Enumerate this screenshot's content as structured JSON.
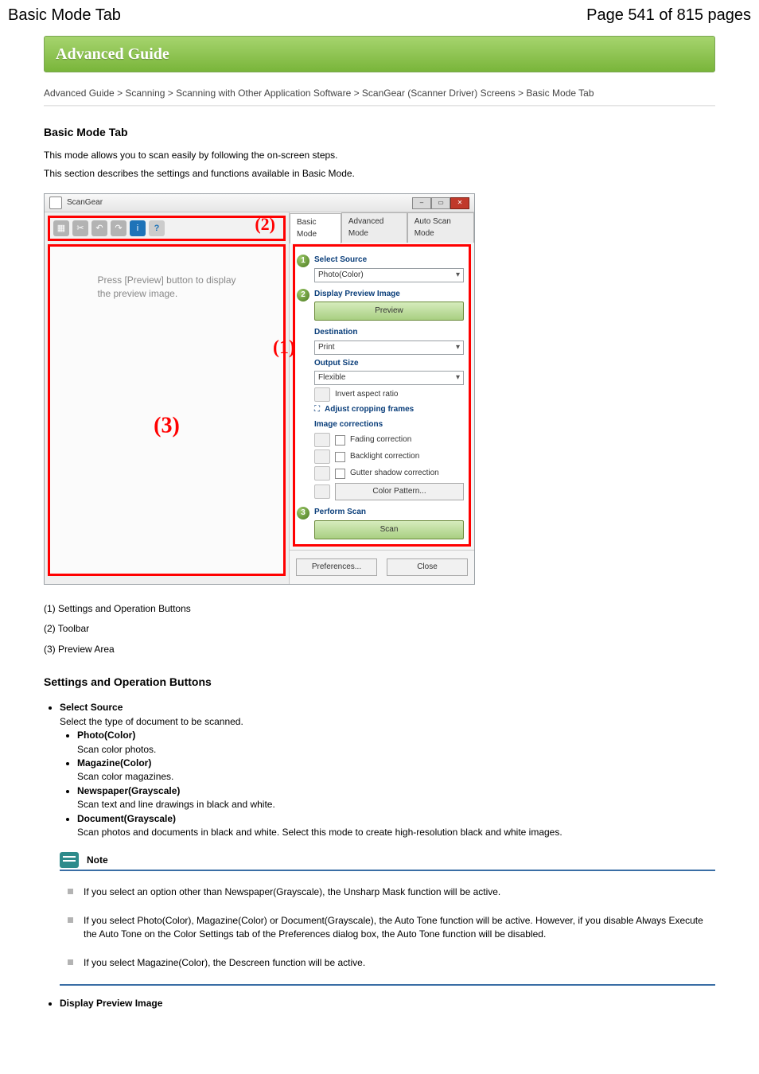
{
  "header": {
    "left_title": "Basic Mode Tab",
    "right_title": "Page 541 of 815 pages"
  },
  "banner": "Advanced Guide",
  "breadcrumbs": "Advanced Guide > Scanning > Scanning with Other Application Software > ScanGear (Scanner Driver) Screens > Basic Mode Tab",
  "title": "Basic Mode Tab",
  "intro": "This mode allows you to scan easily by following the on-screen steps.",
  "intro2": "This section describes the settings and functions available in Basic Mode.",
  "shot": {
    "win_title": "ScanGear",
    "callout_toolbar": "(2)",
    "callout_preview": "(3)",
    "callout_panel": "(1)",
    "preview_msg_l1": "Press [Preview] button to display",
    "preview_msg_l2": "the preview image.",
    "tabs": {
      "basic": "Basic Mode",
      "advanced": "Advanced Mode",
      "auto": "Auto Scan Mode"
    },
    "step1": "1",
    "step2": "2",
    "step3": "3",
    "labels": {
      "select_source": "Select Source",
      "source_value": "Photo(Color)",
      "display_preview": "Display Preview Image",
      "preview_btn": "Preview",
      "destination": "Destination",
      "destination_value": "Print",
      "output_size": "Output Size",
      "output_value": "Flexible",
      "invert": "Invert aspect ratio",
      "adjust_crop": "Adjust cropping frames",
      "image_corr": "Image corrections",
      "fading": "Fading correction",
      "backlight": "Backlight correction",
      "gutter": "Gutter shadow correction",
      "color_pattern": "Color Pattern...",
      "perform_scan": "Perform Scan",
      "scan_btn": "Scan",
      "preferences": "Preferences...",
      "close": "Close"
    }
  },
  "legend": {
    "a": "(1) Settings and Operation Buttons",
    "b": "(2) Toolbar",
    "c": "(3) Preview Area"
  },
  "sb_title": "Settings and Operation Buttons",
  "items": {
    "selsrc_title": "Select Source",
    "selsrc_body": "Select the type of document to be scanned.",
    "photo": "Photo(Color)",
    "photo_body": "Scan color photos.",
    "mag": "Magazine(Color)",
    "mag_body": "Scan color magazines.",
    "news": "Newspaper(Grayscale)",
    "news_body": "Scan text and line drawings in black and white.",
    "docg": "Document(Grayscale)",
    "docg_body": "Scan photos and documents in black and white. Select this mode to create high-resolution black and white images.",
    "note_label": "Note",
    "note1": "If you select an option other than Newspaper(Grayscale), the Unsharp Mask function will be active.",
    "note2": "If you select Photo(Color), Magazine(Color) or Document(Grayscale), the Auto Tone function will be active. However, if you disable Always Execute the Auto Tone on the Color Settings tab of the Preferences dialog box, the Auto Tone function will be disabled.",
    "note3": "If you select Magazine(Color), the Descreen function will be active.",
    "disp_title": "Display Preview Image"
  }
}
